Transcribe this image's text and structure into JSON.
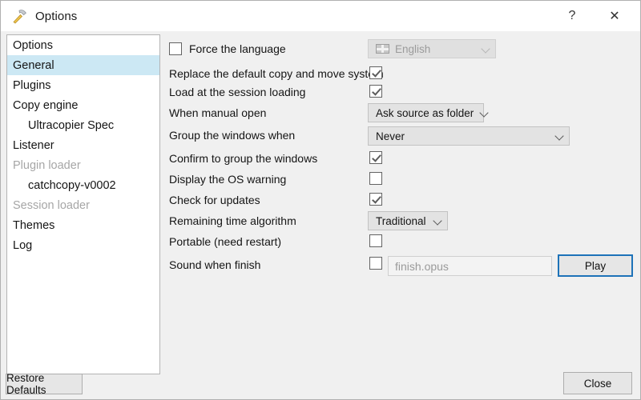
{
  "window": {
    "title": "Options",
    "icon": "hammer-icon",
    "help_label": "?",
    "close_label": "✕"
  },
  "sidebar": {
    "items": [
      {
        "label": "Options",
        "indent": false,
        "selected": false,
        "disabled": false
      },
      {
        "label": "General",
        "indent": false,
        "selected": true,
        "disabled": false
      },
      {
        "label": "Plugins",
        "indent": false,
        "selected": false,
        "disabled": false
      },
      {
        "label": "Copy engine",
        "indent": false,
        "selected": false,
        "disabled": false
      },
      {
        "label": "Ultracopier Spec",
        "indent": true,
        "selected": false,
        "disabled": false
      },
      {
        "label": "Listener",
        "indent": false,
        "selected": false,
        "disabled": false
      },
      {
        "label": "Plugin loader",
        "indent": false,
        "selected": false,
        "disabled": true
      },
      {
        "label": "catchcopy-v0002",
        "indent": true,
        "selected": false,
        "disabled": false
      },
      {
        "label": "Session loader",
        "indent": false,
        "selected": false,
        "disabled": true
      },
      {
        "label": "Themes",
        "indent": false,
        "selected": false,
        "disabled": false
      },
      {
        "label": "Log",
        "indent": false,
        "selected": false,
        "disabled": false
      }
    ]
  },
  "settings": {
    "force_language_label": "Force the language",
    "force_language_checked": false,
    "language_value": "English",
    "language_disabled": true,
    "replace_default_label": "Replace the default copy and move system",
    "replace_default_checked": true,
    "load_session_label": "Load at the session loading",
    "load_session_checked": true,
    "manual_open_label": "When manual open",
    "manual_open_value": "Ask source as folder",
    "group_windows_label": "Group the windows when",
    "group_windows_value": "Never",
    "confirm_group_label": "Confirm to group the windows",
    "confirm_group_checked": true,
    "os_warning_label": "Display the OS warning",
    "os_warning_checked": false,
    "check_updates_label": "Check for updates",
    "check_updates_checked": true,
    "remaining_time_label": "Remaining time algorithm",
    "remaining_time_value": "Traditional",
    "portable_label": "Portable (need restart)",
    "portable_checked": false,
    "sound_label": "Sound when finish",
    "sound_checked": false,
    "sound_file_placeholder": "finish.opus",
    "play_label": "Play"
  },
  "footer": {
    "restore_defaults_label": "Restore Defaults",
    "close_label": "Close"
  },
  "colors": {
    "window_bg": "#f0f0f0",
    "panel_bg": "#ffffff",
    "selection": "#cce8f4",
    "focus_ring": "#1d72b8",
    "disabled_text": "#a6a6a6"
  }
}
